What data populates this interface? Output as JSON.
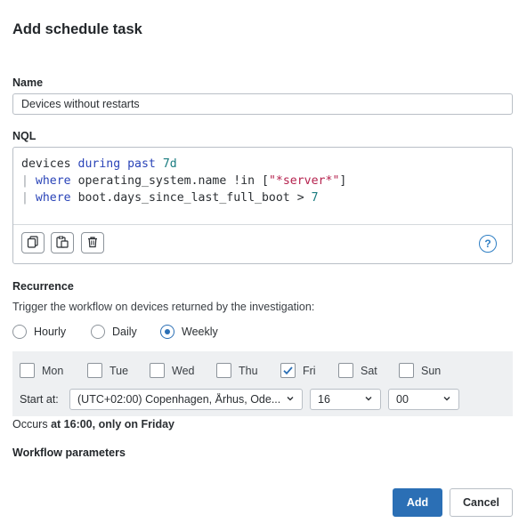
{
  "dialog": {
    "title": "Add schedule task"
  },
  "name": {
    "label": "Name",
    "value": "Devices without restarts"
  },
  "nql": {
    "label": "NQL",
    "line1": {
      "a": "devices",
      "b": "during past",
      "c": "7d"
    },
    "line2": {
      "pipe": "|",
      "kw": "where",
      "field": "operating_system.name",
      "op": "!in",
      "open": "[",
      "str": "\"*server*\"",
      "close": "]"
    },
    "line3": {
      "pipe": "|",
      "kw": "where",
      "field": "boot.days_since_last_full_boot",
      "op": ">",
      "num": "7"
    },
    "tools": [
      "copy-icon",
      "paste-icon",
      "trash-icon"
    ],
    "help": "?"
  },
  "recurrence": {
    "label": "Recurrence",
    "description": "Trigger the workflow on devices returned by the investigation:",
    "options": [
      {
        "label": "Hourly",
        "checked": false
      },
      {
        "label": "Daily",
        "checked": false
      },
      {
        "label": "Weekly",
        "checked": true
      }
    ]
  },
  "days": [
    {
      "label": "Mon",
      "checked": false
    },
    {
      "label": "Tue",
      "checked": false
    },
    {
      "label": "Wed",
      "checked": false
    },
    {
      "label": "Thu",
      "checked": false
    },
    {
      "label": "Fri",
      "checked": true
    },
    {
      "label": "Sat",
      "checked": false
    },
    {
      "label": "Sun",
      "checked": false
    }
  ],
  "start": {
    "label": "Start at:",
    "timezone": "(UTC+02:00) Copenhagen, Århus, Ode...",
    "hour": "16",
    "minute": "00"
  },
  "occurs": {
    "prefix": "Occurs",
    "detail": "at 16:00, only on Friday"
  },
  "workflow_params": {
    "label": "Workflow parameters"
  },
  "actions": {
    "add": "Add",
    "cancel": "Cancel"
  },
  "colors": {
    "primary": "#2b6fb5",
    "keyword": "#2a44b8",
    "number": "#1a7c80",
    "string": "#b5224e",
    "panel": "#eef0f2"
  }
}
